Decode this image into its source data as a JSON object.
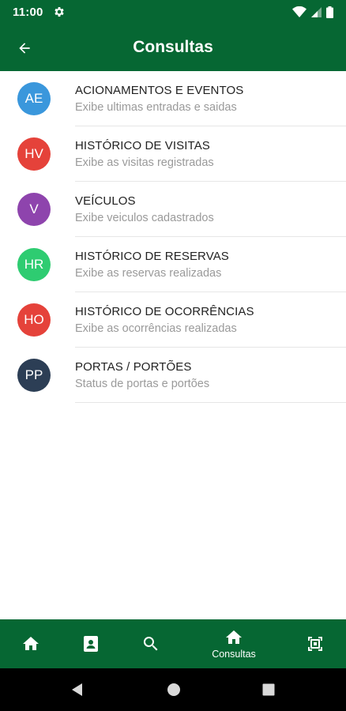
{
  "status_bar": {
    "time": "11:00"
  },
  "app_bar": {
    "title": "Consultas"
  },
  "items": [
    {
      "initials": "AE",
      "title": "ACIONAMENTOS E EVENTOS",
      "subtitle": "Exibe ultimas entradas e saidas",
      "color": "#3a97dc"
    },
    {
      "initials": "HV",
      "title": "HISTÓRICO DE VISITAS",
      "subtitle": "Exibe as visitas registradas",
      "color": "#e5423a"
    },
    {
      "initials": "V",
      "title": "VEÍCULOS",
      "subtitle": "Exibe veiculos cadastrados",
      "color": "#8e44ad"
    },
    {
      "initials": "HR",
      "title": "HISTÓRICO DE RESERVAS",
      "subtitle": "Exibe as reservas realizadas",
      "color": "#2ecc71"
    },
    {
      "initials": "HO",
      "title": "HISTÓRICO DE OCORRÊNCIAS",
      "subtitle": "Exibe as ocorrências realizadas",
      "color": "#e5423a"
    },
    {
      "initials": "PP",
      "title": "PORTAS / PORTÕES",
      "subtitle": "Status de portas e portões",
      "color": "#2c3e55"
    }
  ],
  "bottom_nav": {
    "items": [
      {
        "icon": "home-icon"
      },
      {
        "icon": "contact-card-icon"
      },
      {
        "icon": "search-icon"
      },
      {
        "icon": "home-icon",
        "label": "Consultas",
        "active": true
      },
      {
        "icon": "qr-scan-icon"
      }
    ]
  },
  "colors": {
    "primary": "#066733",
    "nav_bar": "#000000"
  }
}
